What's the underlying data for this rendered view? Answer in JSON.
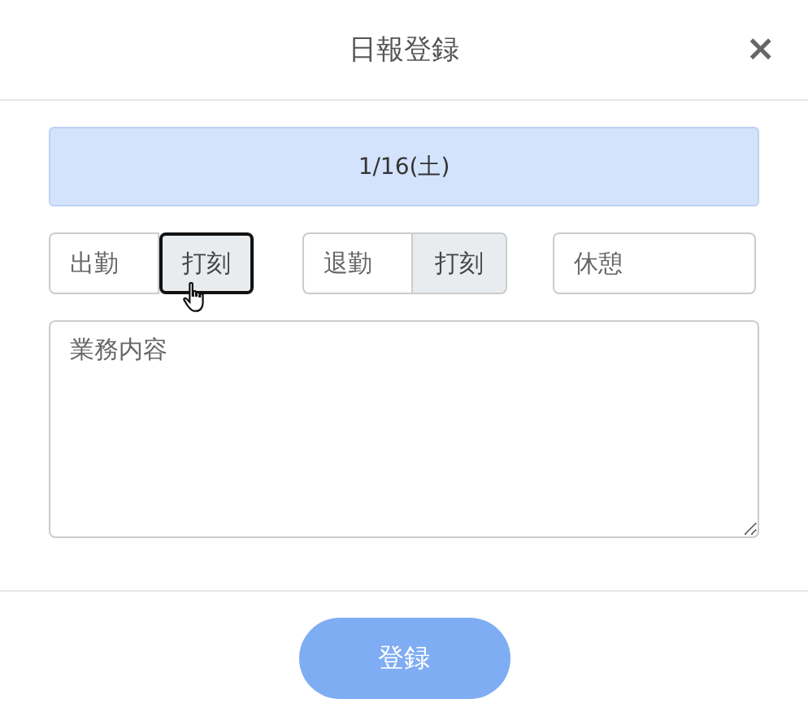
{
  "dialog": {
    "title": "日報登録",
    "close": "×"
  },
  "date": "1/16(土)",
  "fields": [
    {
      "kind": "stamp",
      "placeholder": "出勤",
      "button": "打刻",
      "focused": true
    },
    {
      "kind": "stamp",
      "placeholder": "退勤",
      "button": "打刻",
      "focused": false
    },
    {
      "kind": "plain",
      "placeholder": "休憩"
    }
  ],
  "report": {
    "placeholder": "業務内容"
  },
  "submit": {
    "label": "登録",
    "disabled": true
  }
}
